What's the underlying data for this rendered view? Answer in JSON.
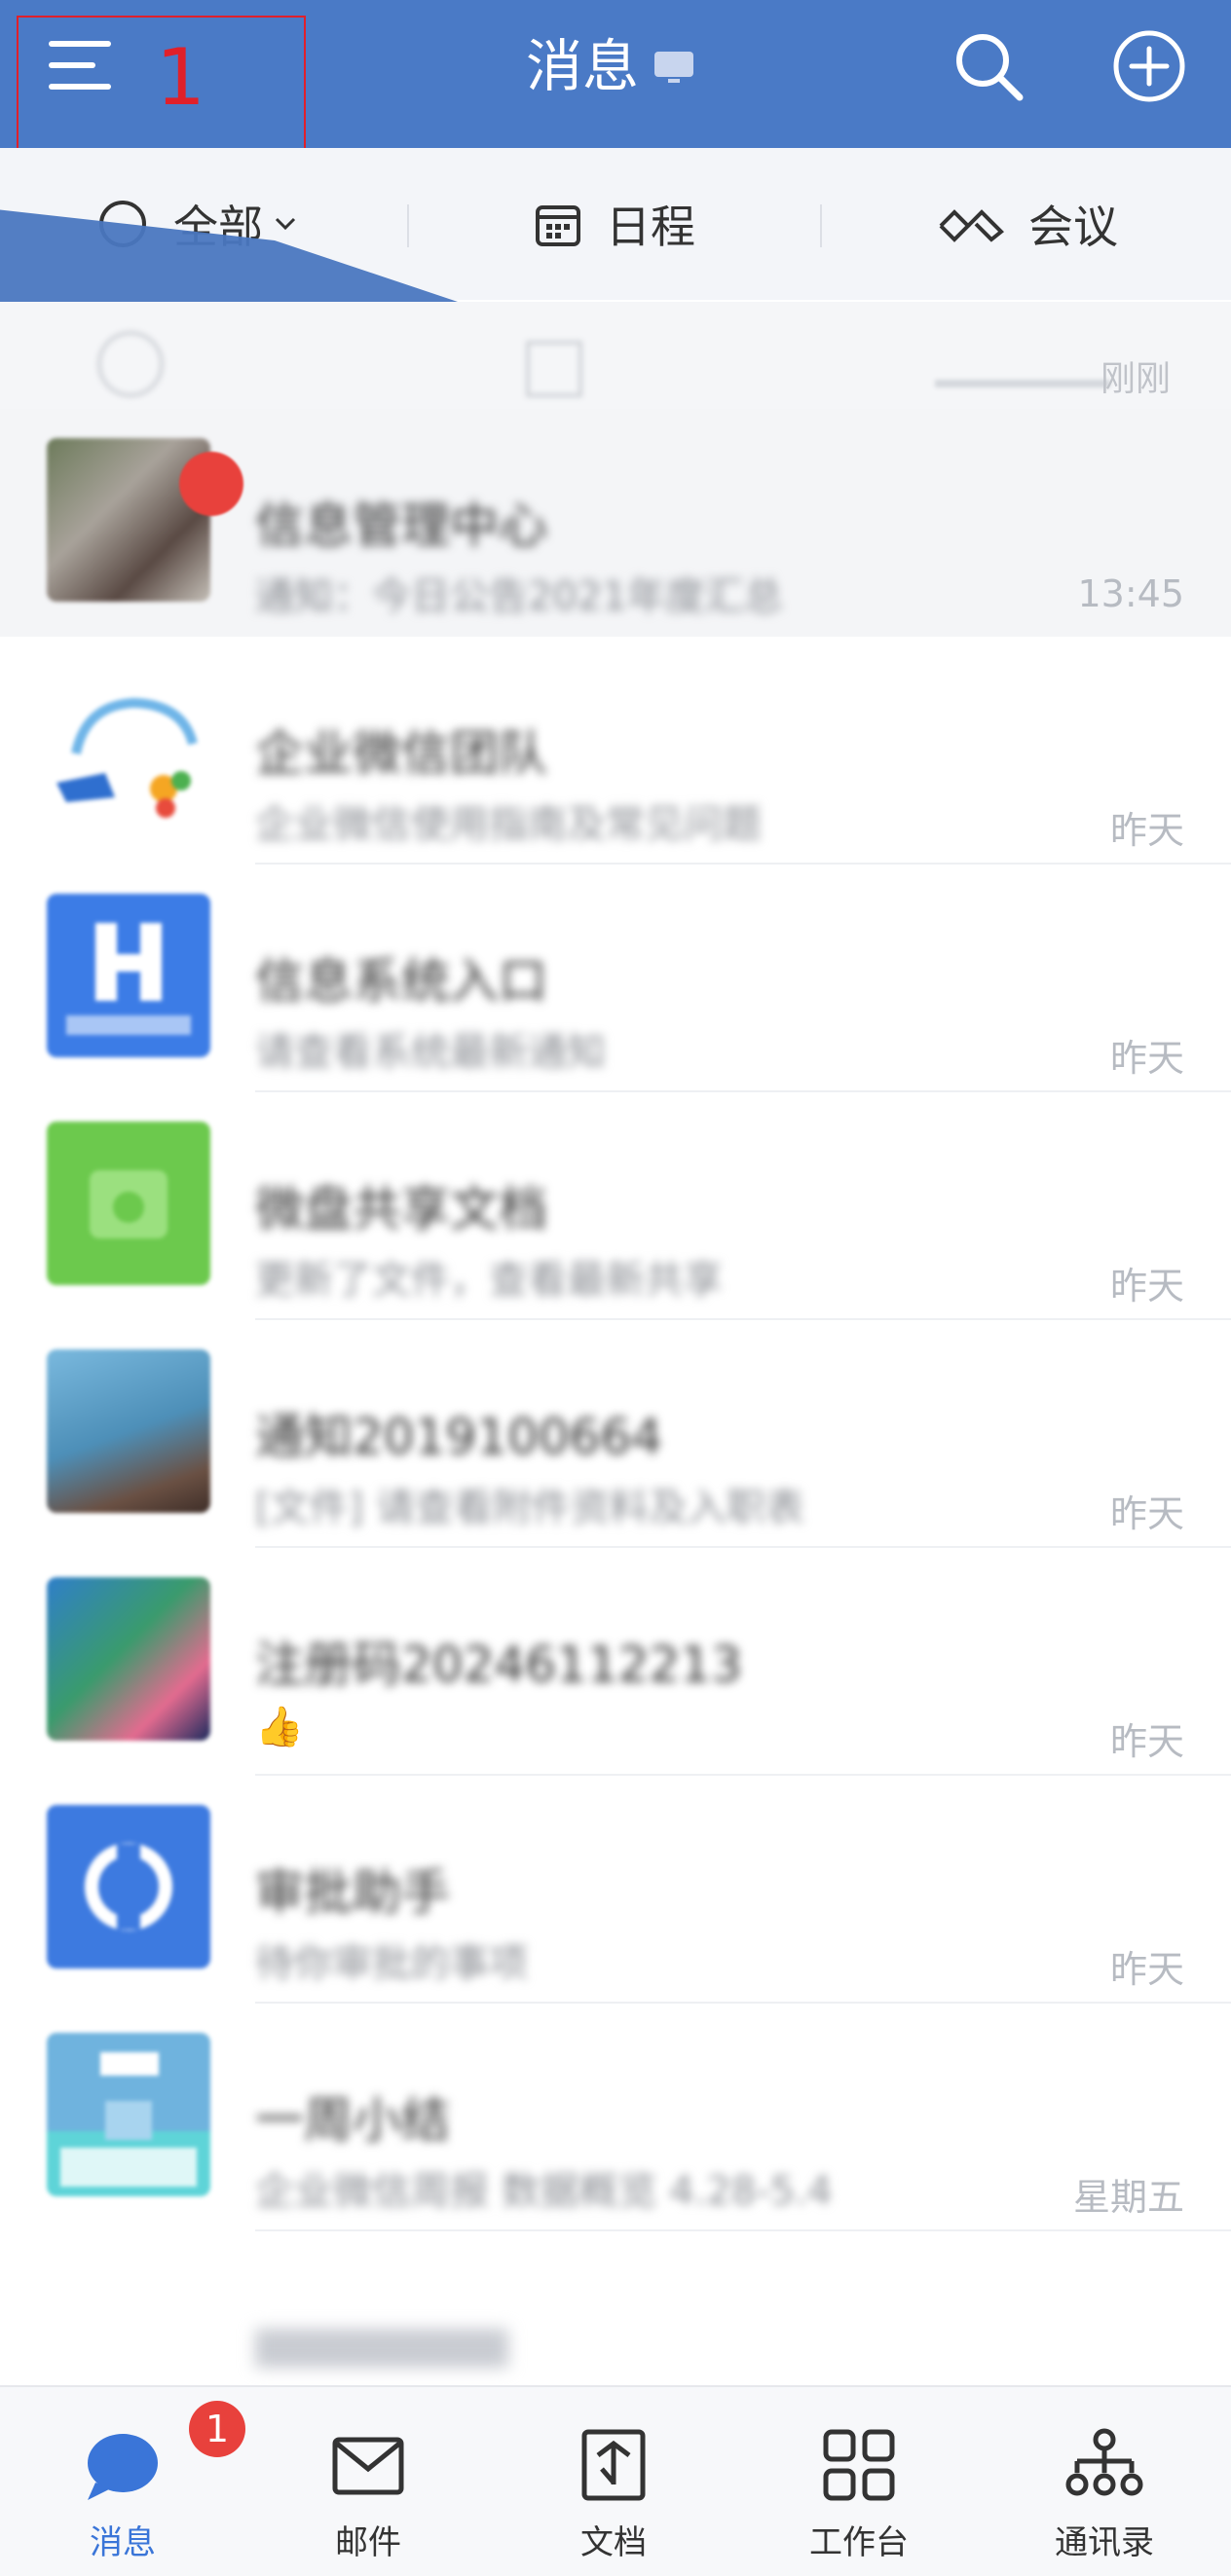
{
  "header": {
    "title": "消息",
    "annotation_number": "1"
  },
  "filter": {
    "all_label": "全部",
    "schedule_label": "日程",
    "meeting_label": "会议"
  },
  "ghost_row": {
    "time": "刚刚"
  },
  "messages": [
    {
      "name": "信息管理中心",
      "preview": "通知：今日公告2021年度汇总",
      "time": "13:45",
      "avatar_color": "#7b6f68",
      "unread": true
    },
    {
      "name": "企业微信团队",
      "preview": "企业微信使用指南及常见问题",
      "time": "昨天",
      "avatar_color": "#ffffff",
      "unread": false
    },
    {
      "name": "信息系统入口",
      "preview": "请查看系统最新通知",
      "time": "昨天",
      "avatar_color": "#3c7ce6",
      "unread": false
    },
    {
      "name": "微盘共享文档",
      "preview": "更新了文件，查看最新共享",
      "time": "昨天",
      "avatar_color": "#6cc94d",
      "unread": false
    },
    {
      "name": "通知2019100664",
      "preview": "[文件] 请查看附件资料及入职表",
      "time": "昨天",
      "avatar_color": "#5a9fc8",
      "unread": false
    },
    {
      "name": "注册码20246112213",
      "preview": "👍",
      "time": "昨天",
      "avatar_color": "#3a8b6a",
      "unread": false
    },
    {
      "name": "审批助手",
      "preview": "待你审批的事项",
      "time": "昨天",
      "avatar_color": "#3d7ae0",
      "unread": false
    },
    {
      "name": "一周小结",
      "preview": "企业微信周报 数据概览 4.28-5.4",
      "time": "星期五",
      "avatar_color": "#6fb3de",
      "unread": false
    }
  ],
  "tabbar": {
    "items": [
      {
        "label": "消息",
        "badge": "1"
      },
      {
        "label": "邮件"
      },
      {
        "label": "文档"
      },
      {
        "label": "工作台"
      },
      {
        "label": "通讯录"
      }
    ]
  },
  "colors": {
    "brand": "#4a7ac6",
    "active_tab": "#3a75d8",
    "badge": "#e8413c"
  }
}
